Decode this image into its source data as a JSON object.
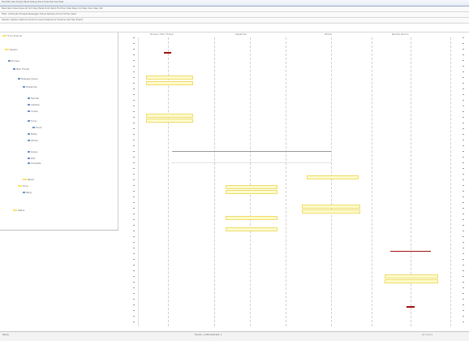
{
  "window": {
    "menu_text": "File  Edit  View  Project  Build  Debug  Trace  Tools  Window  Help"
  },
  "toolbars": [
    "New  Open  Save  Save All   Cut  Copy  Paste   Undo  Redo   Find   Run   Stop   Step Into   Step Over   Step Out",
    "Filter:  All Events   Threads  Messages  Timers  Markers   Zoom  Fit  Prev  Next",
    "Session  Capture  Options  Columns  Layout   Sequence  Timeline  Call Tree  Export"
  ],
  "tree": {
    "title": "Trace Explorer",
    "rows": [
      "Session",
      "Process",
      "Main Thread",
      "Message Queue",
      "Dispatcher",
      "Handler",
      "Callback",
      "Invoke",
      "Timer",
      "Event",
      "Notify",
      "Worker",
      "Queue",
      "Post",
      "Complete",
      "Result",
      "Done",
      "Reply",
      "Status"
    ]
  },
  "columns": [
    "Process / Main Thread",
    "Dispatcher",
    "Worker",
    "Remote Service"
  ],
  "status": {
    "left": "Ready",
    "middle": "Events: 1,248   Selected: 1",
    "right": "Ln 1  Col 1"
  }
}
